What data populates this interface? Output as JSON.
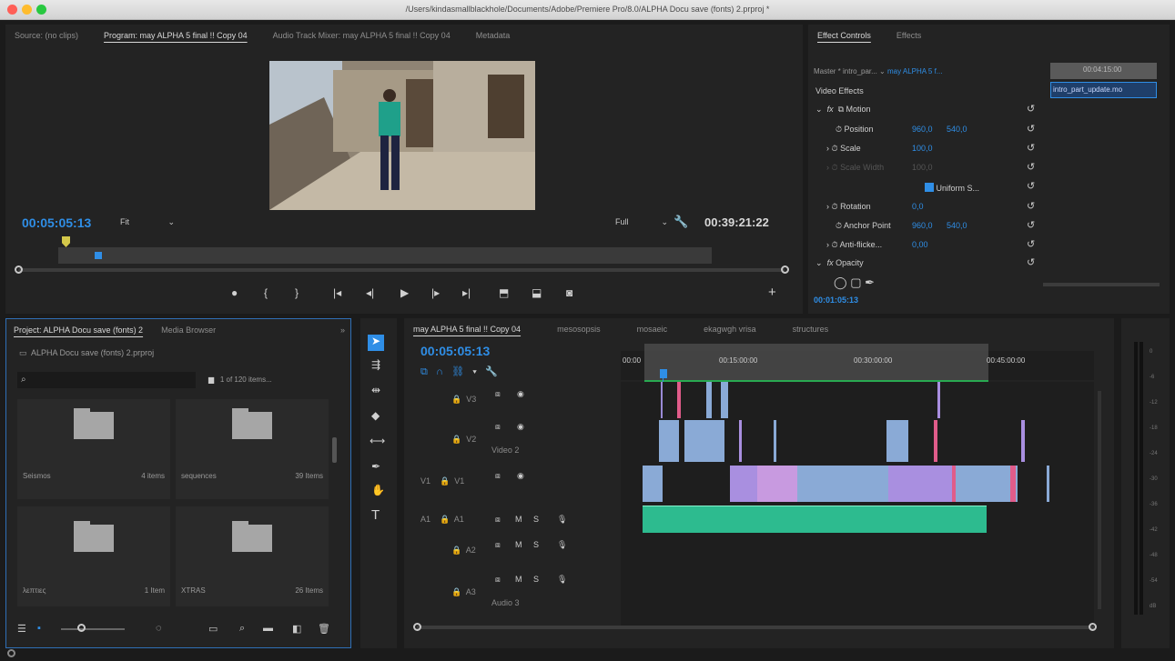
{
  "window": {
    "title": "/Users/kindasmallblackhole/Documents/Adobe/Premiere Pro/8.0/ALPHA Docu save (fonts) 2.prproj *"
  },
  "program_monitor": {
    "tabs": [
      "Source: (no clips)",
      "Program: may ALPHA 5 final !! Copy 04",
      "Audio Track Mixer: may ALPHA 5 final !! Copy 04",
      "Metadata"
    ],
    "timecode": "00:05:05:13",
    "zoom": "Fit",
    "resolution": "Full",
    "duration": "00:39:21:22"
  },
  "effect_controls": {
    "tabs": [
      "Effect Controls",
      "Effects"
    ],
    "master": "Master * intro_par...",
    "sequence": "may ALPHA 5 f...",
    "mini_timecode": "00:04:15:00",
    "clip_name": "intro_part_update.mo",
    "section": "Video Effects",
    "motion_label": "Motion",
    "position_label": "Position",
    "position_x": "960,0",
    "position_y": "540,0",
    "scale_label": "Scale",
    "scale_value": "100,0",
    "scale_width_label": "Scale Width",
    "scale_width_value": "100,0",
    "uniform_label": "Uniform S...",
    "rotation_label": "Rotation",
    "rotation_value": "0,0",
    "anchor_label": "Anchor Point",
    "anchor_x": "960,0",
    "anchor_y": "540,0",
    "antiflicker_label": "Anti-flicke...",
    "antiflicker_value": "0,00",
    "opacity_label": "Opacity",
    "timecode": "00:01:05:13"
  },
  "project": {
    "tabs": [
      "Project: ALPHA Docu save (fonts) 2",
      "Media Browser"
    ],
    "file": "ALPHA Docu save (fonts) 2.prproj",
    "items_count": "1 of 120 items...",
    "bins": [
      {
        "name": "Seismos",
        "count": "4 items"
      },
      {
        "name": "sequences",
        "count": "39 Items"
      },
      {
        "name": "λεπτιες",
        "count": "1 Item"
      },
      {
        "name": "XTRAS",
        "count": "26 Items"
      }
    ]
  },
  "timeline": {
    "tabs": [
      "may ALPHA 5 final !! Copy 04",
      "mesosopsis",
      "mosaeic",
      "ekagwgh vrisa",
      "structures"
    ],
    "timecode": "00:05:05:13",
    "ruler": [
      "00:00",
      "00:15:00:00",
      "00:30:00:00",
      "00:45:00:00"
    ],
    "tracks": [
      {
        "label": "V3",
        "name": ""
      },
      {
        "label": "V2",
        "name": "Video 2"
      },
      {
        "label": "V1",
        "name": "",
        "source": "V1"
      },
      {
        "label": "A1",
        "name": "",
        "source": "A1"
      },
      {
        "label": "A2",
        "name": ""
      },
      {
        "label": "A3",
        "name": "Audio 3"
      }
    ]
  },
  "meter": {
    "ticks": [
      "0",
      "-6",
      "-12",
      "-18",
      "-24",
      "-30",
      "-36",
      "-42",
      "-48",
      "-54",
      "dB"
    ]
  },
  "colors": {
    "accent": "#2f8ee6",
    "audio_clip": "#2dbb8f",
    "video_clip": "#8aaad6",
    "pink_clip": "#e05c8a",
    "purple_clip": "#a98fe0"
  }
}
